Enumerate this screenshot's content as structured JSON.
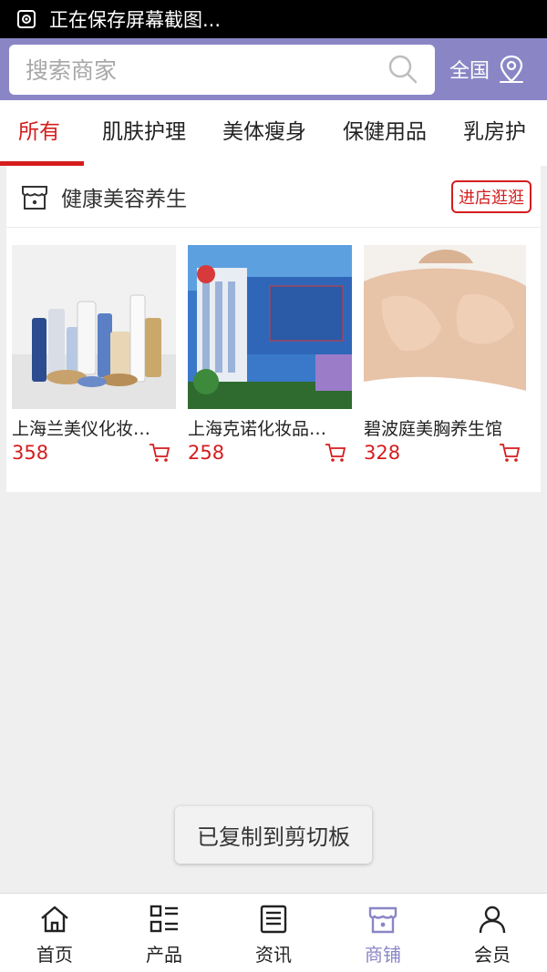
{
  "status_bar": {
    "text": "正在保存屏幕截图..."
  },
  "header": {
    "search_placeholder": "搜索商家",
    "region_label": "全国"
  },
  "tabs": [
    {
      "label": "所有",
      "active": true
    },
    {
      "label": "肌肤护理"
    },
    {
      "label": "美体瘦身"
    },
    {
      "label": "保健用品"
    },
    {
      "label": "乳房护"
    }
  ],
  "shop": {
    "name": "健康美容养生",
    "visit_button": "进店逛逛",
    "products": [
      {
        "name": "上海兰美仪化妆…",
        "price": "358"
      },
      {
        "name": "上海克诺化妆品…",
        "price": "258"
      },
      {
        "name": "碧波庭美胸养生馆",
        "price": "328"
      }
    ]
  },
  "toast": {
    "text": "已复制到剪切板"
  },
  "bottom_nav": [
    {
      "label": "首页",
      "icon": "home-icon"
    },
    {
      "label": "产品",
      "icon": "grid-list-icon"
    },
    {
      "label": "资讯",
      "icon": "news-icon"
    },
    {
      "label": "商铺",
      "icon": "store-icon",
      "active": true
    },
    {
      "label": "会员",
      "icon": "user-icon"
    }
  ],
  "colors": {
    "accent": "#8a86c6",
    "brand_red": "#d51d1d"
  }
}
